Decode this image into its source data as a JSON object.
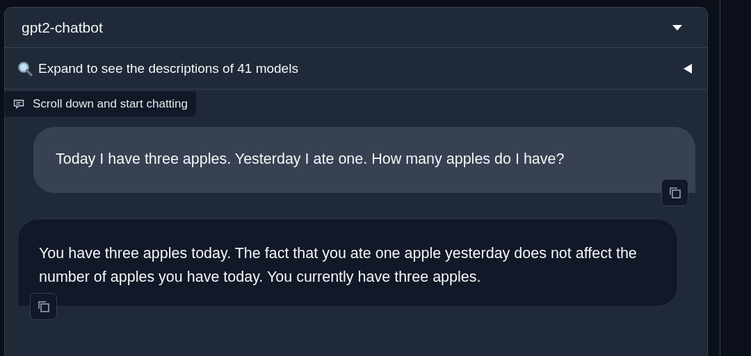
{
  "model_dropdown": {
    "value": "gpt2-chatbot"
  },
  "accordion": {
    "label": "Expand to see the descriptions of 41 models",
    "expanded": false
  },
  "chatbot": {
    "label": "Scroll down and start chatting",
    "messages": [
      {
        "kind": "user",
        "text": "Today I have three apples. Yesterday I ate one. How many apples do I have?"
      },
      {
        "kind": "bot",
        "text": "You have three apples today. The fact that you ate one apple yesterday does not affect the number of apples you have today. You currently have three apples."
      }
    ]
  }
}
